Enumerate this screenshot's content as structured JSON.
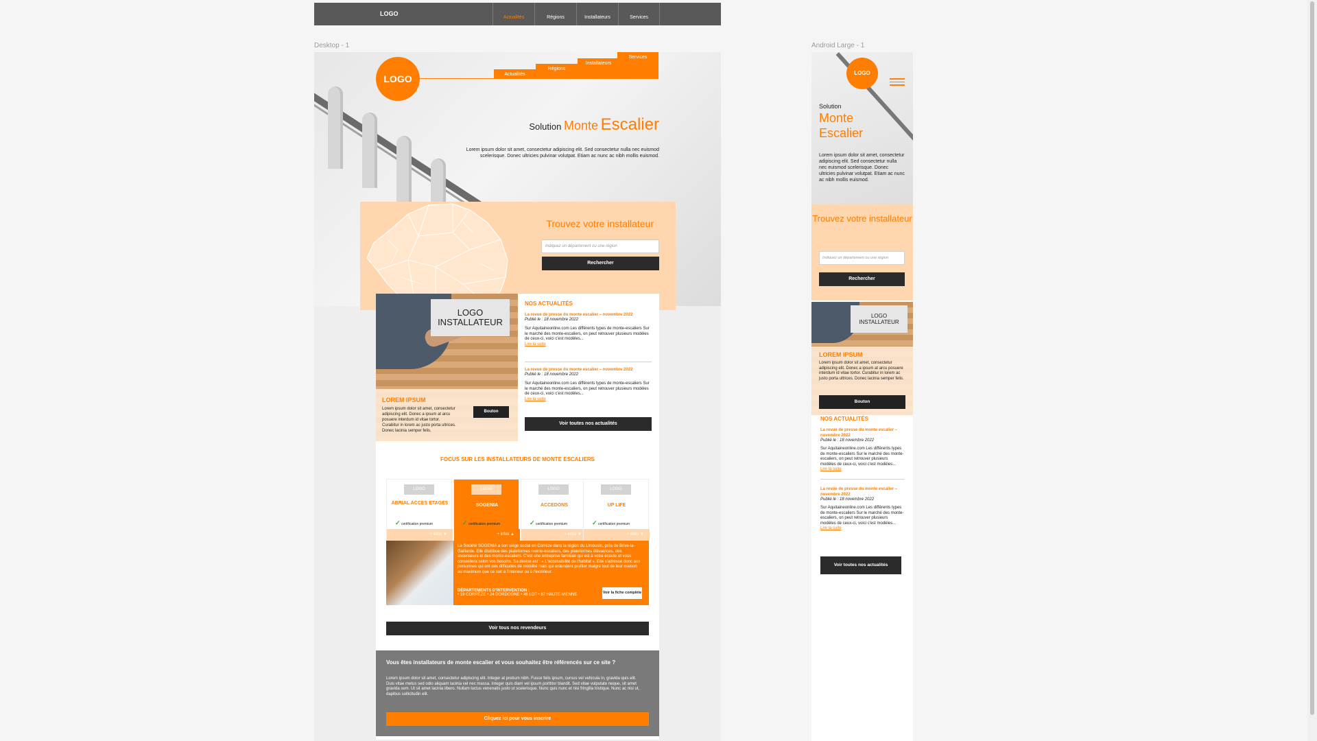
{
  "topnav": {
    "logo": "LOGO",
    "items": [
      "Actualités",
      "Régions",
      "Installateurs",
      "Services"
    ],
    "active_index": 0
  },
  "frames": {
    "desktop_label": "Desktop - 1",
    "mobile_label": "Android Large - 1"
  },
  "desktop": {
    "logo": "LOGO",
    "nav": [
      "Actualités",
      "Régions",
      "Installateurs",
      "Services"
    ],
    "hero": {
      "title_a": "Solution",
      "title_b": "Monte",
      "title_c": "Escalier",
      "text": "Lorem ipsum dolor sit amet, consectetur adipiscing elit. Sed consectetur nulla nec euismod scelerisque. Donec ultricies pulvinar volutpat. Etiam ac nunc ac nibh mollis euismod."
    },
    "finder": {
      "title": "Trouvez votre installateur",
      "placeholder": "Indiquez un département ou une région",
      "button": "Rechercher"
    },
    "promo": {
      "logo": "LOGO INSTALLATEUR",
      "title": "LOREM IPSUM",
      "text": "Lorem ipsum dolor sit amet, consectetur adipiscing elit. Donec a ipsum at arcu posuere interdum id vitae tortor. Curabitur in lorem ac justo porta ultrices. Donec lacinia semper felis.",
      "button": "Bouton"
    },
    "news": {
      "heading": "NOS ACTUALITÉS",
      "articles": [
        {
          "title": "La revue de presse du monte escalier – novembre 2022",
          "date": "Publié le : 18 novembre 2022",
          "body": "Sur Aquitaineonline.com Les différents types de monte-escaliers Sur le marché des monte-escaliers, on peut retrouver plusieurs modèles de ceux-ci, voici c'est modèles...",
          "link": "Lire la suite"
        },
        {
          "title": "La revue de presse du monte escalier – novembre 2022",
          "date": "Publié le : 18 novembre 2022",
          "body": "Sur Aquitaineonline.com Les différents types de monte-escaliers Sur le marché des monte-escaliers, on peut retrouver plusieurs modèles de ceux-ci, voici c'est modèles...",
          "link": "Lire la suite"
        }
      ],
      "button": "Voir toutes nos actualités"
    },
    "focus": {
      "title": "FOCUS SUR LES INSTALLATEURS DE MONTE ESCALIERS",
      "cards": [
        {
          "logo": "LOGO",
          "name": "ABRIAL ACCES ETAGES",
          "cert": "certification premium",
          "info": "+ infos ▼"
        },
        {
          "logo": "LOGO",
          "name": "SOGENIA",
          "cert": "certification premium",
          "info": "+ infos ▲"
        },
        {
          "logo": "LOGO",
          "name": "ACCEDONS",
          "cert": "certification premium",
          "info": "+ infos ▼"
        },
        {
          "logo": "LOGO",
          "name": "UP LIFE",
          "cert": "certification premium",
          "info": "+ infos ▼"
        }
      ],
      "detail_text": "La Société SOGENIA a son siège social en Corrèze dans la région du Limousin, près de Brive-la-Gaillarde. Elle distribue des plateformes monte-escaliers, des plateformes élévatrices, des ascenseurs et des monte-escaliers. C'est une entreprise familiale qui est à votre écoute et vous conseillera selon vos besoins. Sa devise est : « L'accessibilité de l'habitat ». Elle s'adresse donc aux personnes qui ont des difficultés de mobilité mais qui entendent profiter malgré tout de leur maison au maximum que ce soit à l'intérieur ou à l'extérieur.",
      "dep_label": "DÉPARTEMENTS D'INTERVENTION :",
      "dep_list": "• 19 CORRÈZE • 24 DORDOGNE • 46 LOT • 87 HAUTE-VIENNE",
      "fiche_button": "Voir la fiche complète",
      "resellers_button": "Voir tous nos revendeurs"
    },
    "join": {
      "title": "Vous êtes installateurs de monte escalier et vous souhaitez être référencés sur ce site ?",
      "text": "Lorem ipsum dolor sit amet, consectetur adipiscing elit. Integer at pretium nibh. Fusce felis ipsum, cursus vel vehicula in, gravida quis elit. Duis vitae metus sed odio aliquam lacinia vel nec massa. Integer quis diam vel ipsum porttitor blandit. Sed vitae vulputate neque, sit amet gravida sem. Ut sit amet lacinia libero. Nullam luctus venenatis justo ut scelerisque. Nunc quis nunc et nisi fringilla tristique. Nunc ac nisi ut, dapibus sollicitudin elit.",
      "button": "Cliquez ici pour vous inscrire"
    }
  },
  "mobile": {
    "logo": "LOGO",
    "hero": {
      "title_a": "Solution",
      "title_b": "Monte",
      "title_c": "Escalier",
      "text": "Lorem ipsum dolor sit amet, consectetur adipiscing elit. Sed consectetur nulla nec euismod scelerisque. Donec ultricies pulvinar volutpat. Etiam ac nunc ac nibh mollis euismod."
    },
    "finder": {
      "title": "Trouvez votre installateur",
      "placeholder": "Indiquez un département ou une région",
      "button": "Rechercher"
    },
    "promo": {
      "logo": "LOGO INSTALLATEUR",
      "title": "LOREM IPSUM",
      "text": "Lorem ipsum dolor sit amet, consectetur adipiscing elit. Donec a ipsum at arcu posuere interdum id vitae tortor. Curabitur in lorem ac justo porta ultrices. Donec lacinia semper felis.",
      "button": "Bouton"
    },
    "news": {
      "heading": "NOS ACTUALITÉS",
      "articles": [
        {
          "title": "La revue de presse du monte escalier – novembre 2022",
          "date": "Publié le : 18 novembre 2022",
          "body": "Sur Aquitaineonline.com Les différents types de monte-escaliers Sur le marché des monte-escaliers, on peut retrouver plusieurs modèles de ceux-ci, voici c'est modèles...",
          "link": "Lire la suite"
        },
        {
          "title": "La revue de presse du monte escalier – novembre 2022",
          "date": "Publié le : 18 novembre 2022",
          "body": "Sur Aquitaineonline.com Les différents types de monte-escaliers Sur le marché des monte-escaliers, on peut retrouver plusieurs modèles de ceux-ci, voici c'est modèles...",
          "link": "Lire la suite"
        }
      ],
      "button": "Voir toutes nos actualités"
    }
  },
  "colors": {
    "accent": "#ff7d00",
    "accent_light": "#ffd6ad",
    "dark": "#2b2b2b",
    "nav_bg": "#595959",
    "canvas": "#f5f5f5"
  }
}
